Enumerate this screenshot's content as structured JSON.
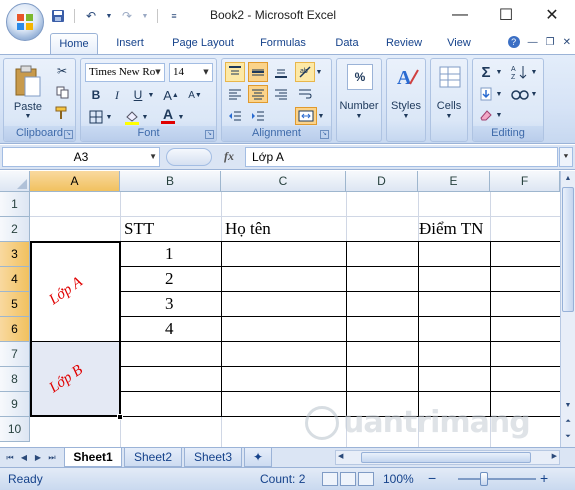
{
  "window": {
    "title": "Book2 - Microsoft Excel",
    "controls": [
      "—",
      "☐",
      "✕"
    ]
  },
  "qat": {
    "icons": [
      "save-icon",
      "undo-icon",
      "redo-icon",
      "customize-icon"
    ]
  },
  "tabs": [
    {
      "label": "Home",
      "active": true
    },
    {
      "label": "Insert"
    },
    {
      "label": "Page Layout"
    },
    {
      "label": "Formulas"
    },
    {
      "label": "Data"
    },
    {
      "label": "Review"
    },
    {
      "label": "View"
    }
  ],
  "ribbon": {
    "clipboard": {
      "label": "Clipboard",
      "paste": "Paste"
    },
    "font": {
      "label": "Font",
      "name": "Times New Ro",
      "size": "14",
      "bold": "B",
      "italic": "I",
      "underline": "U",
      "font_color": "A"
    },
    "alignment": {
      "label": "Alignment"
    },
    "number": {
      "label": "Number",
      "icon_text": "%"
    },
    "styles": {
      "label": "Styles"
    },
    "cells": {
      "label": "Cells"
    },
    "editing": {
      "label": "Editing",
      "sum": "Σ"
    }
  },
  "formula_bar": {
    "name_box": "A3",
    "fx": "fx",
    "content": "Lớp A"
  },
  "grid": {
    "columns": [
      "A",
      "B",
      "C",
      "D",
      "E",
      "F"
    ],
    "selected_column": "A",
    "rows": [
      "1",
      "2",
      "3",
      "4",
      "5",
      "6",
      "7",
      "8",
      "9",
      "10"
    ],
    "selected_rows": [
      "3",
      "4",
      "5",
      "6"
    ],
    "cells": {
      "B2": "STT",
      "C2": "Họ tên",
      "E2": "Điểm TN",
      "B3": "1",
      "B4": "2",
      "B5": "3",
      "B6": "4",
      "A3_6": "Lớp A",
      "A7_9": "Lớp B"
    },
    "text_color_red": "#e00000"
  },
  "sheets": [
    {
      "label": "Sheet1",
      "active": true
    },
    {
      "label": "Sheet2"
    },
    {
      "label": "Sheet3"
    }
  ],
  "status": {
    "ready": "Ready",
    "count": "Count: 2",
    "zoom": "100%",
    "minus": "−",
    "plus": "+"
  },
  "watermark": "uantrimang"
}
